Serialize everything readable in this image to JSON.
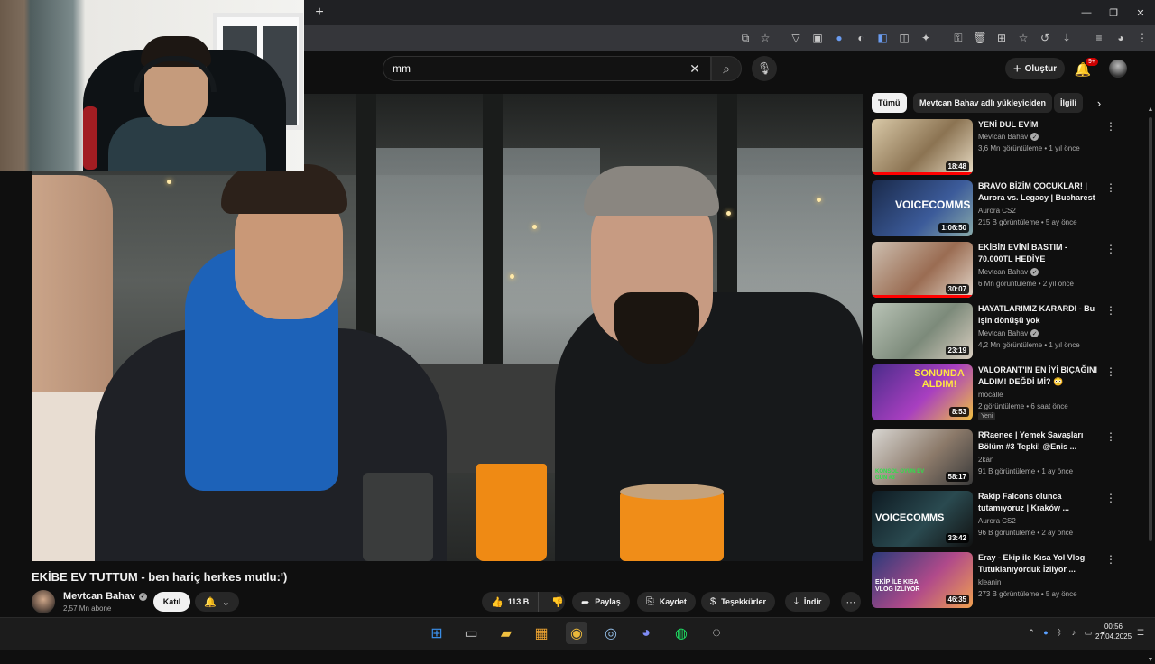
{
  "browser": {
    "new_tab_icon": "plus-icon",
    "window_controls": [
      "minimize-icon",
      "restore-icon",
      "close-icon"
    ],
    "toolbar_icons": [
      "install-icon",
      "bookmark-star-icon",
      "ext-1-icon",
      "ext-2-icon",
      "ext-3-icon",
      "ext-4-icon",
      "ext-5-icon",
      "extensions-icon",
      "ext-6-icon",
      "ext-7-icon",
      "ext-8-icon",
      "ext-9-icon",
      "history-icon",
      "download-icon",
      "tab-search-icon",
      "profile-icon",
      "menu-icon"
    ]
  },
  "youtube": {
    "search": {
      "value": "mm"
    },
    "create_label": "Oluştur",
    "notification_badge": "9+",
    "video": {
      "title": "EKİBE EV TUTTUM - ben hariç herkes mutlu:')",
      "channel": "Mevtcan Bahav",
      "subscribers": "2,57 Mn abone",
      "join_label": "Katıl",
      "likes": "113 B",
      "share_label": "Paylaş",
      "save_label": "Kaydet",
      "thanks_label": "Teşekkürler",
      "download_label": "İndir"
    },
    "chips": [
      "Tümü",
      "Mevtcan Bahav adlı yükleyiciden",
      "İlgili"
    ],
    "recommendations": [
      {
        "title": "YENİ DUL EVİM",
        "channel": "Mevtcan Bahav",
        "verified": true,
        "meta": "3,6 Mn görüntüleme • 1 yıl önce",
        "duration": "18:48",
        "watched": 1.0
      },
      {
        "title": "BRAVO BİZİM ÇOCUKLAR! | Aurora vs. Legacy | Bucharest ...",
        "channel": "Aurora CS2",
        "verified": false,
        "meta": "215 B görüntüleme • 5 ay önce",
        "duration": "1:06:50",
        "watched": 0.0,
        "thumb_text": "VOICECOMMS"
      },
      {
        "title": "EKİBİN EVİNİ BASTIM - 70.000TL HEDİYE",
        "channel": "Mevtcan Bahav",
        "verified": true,
        "meta": "6 Mn görüntüleme • 2 yıl önce",
        "duration": "30:07",
        "watched": 1.0
      },
      {
        "title": "HAYATLARIMIZ KARARDI - Bu işin dönüşü yok",
        "channel": "Mevtcan Bahav",
        "verified": true,
        "meta": "4,2 Mn görüntüleme • 1 yıl önce",
        "duration": "23:19",
        "watched": 0.0
      },
      {
        "title": "VALORANT'IN EN İYİ BIÇAĞINI ALDIM! DEĞDİ Mİ? 😳",
        "channel": "mocalle",
        "verified": false,
        "meta": "2 görüntüleme • 6 saat önce",
        "duration": "8:53",
        "badge": "Yeni",
        "watched": 0.0,
        "thumb_text": "SONUNDA ALDIM!"
      },
      {
        "title": "RRaenee | Yemek Savaşları Bölüm #3 Tepki! @Enis ...",
        "channel": "2kan",
        "verified": false,
        "meta": "91 B görüntüleme • 1 ay önce",
        "duration": "58:17",
        "watched": 0.0,
        "thumb_text": "KONSOL OYUN EV GÜN #3"
      },
      {
        "title": "Rakip Falcons olunca tutamıyoruz | Kraków ...",
        "channel": "Aurora CS2",
        "verified": false,
        "meta": "96 B görüntüleme • 2 ay önce",
        "duration": "33:42",
        "watched": 0.0,
        "thumb_text": "VOICECOMMS"
      },
      {
        "title": "Eray - Ekip ile Kısa Yol Vlog Tutuklanıyorduk İzliyor ...",
        "channel": "kleanin",
        "verified": false,
        "meta": "273 B görüntüleme • 5 ay önce",
        "duration": "46:35",
        "watched": 0.0,
        "thumb_text": "EKİP İLE KISA VLOG İZLİYOR"
      }
    ]
  },
  "taskbar": {
    "apps": [
      "windows-start-icon",
      "file-explorer-alt-icon",
      "file-explorer-icon",
      "microsoft-store-icon",
      "chrome-icon",
      "steam-icon",
      "discord-icon",
      "spotify-icon",
      "obs-icon"
    ],
    "tray": [
      "chevron-up-icon",
      "microphone-icon",
      "bluetooth-icon",
      "audio-icon",
      "network-icon",
      "speaker-icon"
    ],
    "time": "00:56",
    "date": "27.04.2025"
  }
}
